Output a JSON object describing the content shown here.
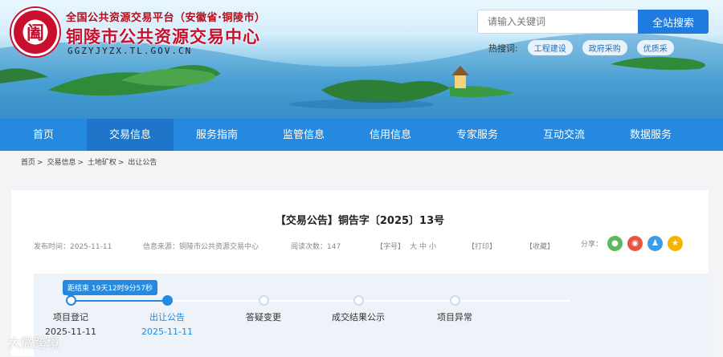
{
  "header": {
    "platform_title": "全国公共资源交易平台（安徽省·铜陵市）",
    "center_name": "铜陵市公共资源交易中心",
    "url": "GGZYJYZX.TL.GOV.CN",
    "logo_glyph": "阖"
  },
  "search": {
    "placeholder": "请输入关键词",
    "button_label": "全站搜索",
    "hot_label": "热搜词:",
    "hot_tags": [
      "工程建设",
      "政府采购",
      "优质采"
    ]
  },
  "nav": {
    "items": [
      "首页",
      "交易信息",
      "服务指南",
      "监管信息",
      "信用信息",
      "专家服务",
      "互动交流",
      "数据服务"
    ],
    "active_index": 1
  },
  "breadcrumb": [
    "首页",
    "交易信息",
    "土地矿权",
    "出让公告"
  ],
  "article": {
    "title": "【交易公告】铜告字〔2025〕13号",
    "publish_time": "发布时间：2025-11-11",
    "source": "信息来源：铜陵市公共资源交易中心",
    "views": "阅读次数：147",
    "font_size_label": "【字号】",
    "font_sizes": [
      "大",
      "中",
      "小"
    ],
    "print": "【打印】",
    "favorite": "【收藏】",
    "share_label": "分享："
  },
  "progress": {
    "countdown": "距结束  19天12时9分57秒",
    "steps": [
      {
        "label": "项目登记",
        "date": "2025-11-11",
        "status": "done"
      },
      {
        "label": "出让公告",
        "date": "2025-11-11",
        "status": "current"
      },
      {
        "label": "答疑变更",
        "date": "",
        "status": "pending"
      },
      {
        "label": "成交结果公示",
        "date": "",
        "status": "pending"
      },
      {
        "label": "项目异常",
        "date": "",
        "status": "pending"
      }
    ]
  },
  "watermark": "大微跨境",
  "colors": {
    "brand_blue": "#2589df",
    "title_red": "#c8102e"
  }
}
